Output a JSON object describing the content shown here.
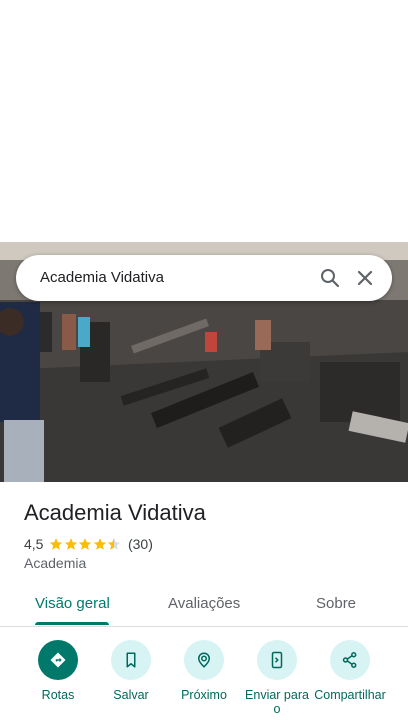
{
  "search": {
    "query": "Academia Vidativa"
  },
  "place": {
    "title": "Academia Vidativa",
    "rating": "4,5",
    "stars": 4.5,
    "review_count": "(30)",
    "category": "Academia"
  },
  "tabs": [
    {
      "label": "Visão geral",
      "active": true
    },
    {
      "label": "Avaliações",
      "active": false
    },
    {
      "label": "Sobre",
      "active": false
    }
  ],
  "actions": [
    {
      "label": "Rotas",
      "icon": "directions-icon"
    },
    {
      "label": "Salvar",
      "icon": "bookmark-icon"
    },
    {
      "label": "Próximo",
      "icon": "nearby-icon"
    },
    {
      "label": "Enviar para o",
      "icon": "send-to-phone-icon"
    },
    {
      "label": "Compartilhar",
      "icon": "share-icon"
    }
  ],
  "colors": {
    "accent": "#00796b",
    "action_bg": "#d8f3f3",
    "star": "#fbbc04"
  }
}
